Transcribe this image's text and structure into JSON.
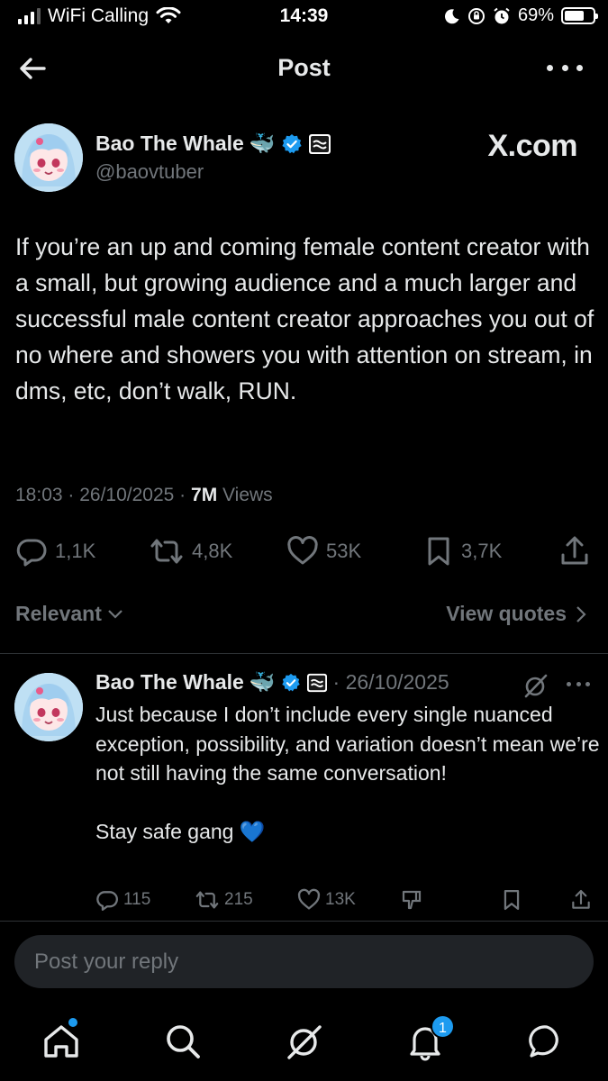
{
  "status_bar": {
    "carrier": "WiFi Calling",
    "time": "14:39",
    "battery": "69%",
    "battery_level": 0.69
  },
  "header": {
    "title": "Post"
  },
  "post": {
    "author_name": "Bao The Whale",
    "name_emoji": "🐳",
    "handle": "@baovtuber",
    "brand": "X.com",
    "text": "If you’re an up and coming female content creator with a small, but growing audience and a much larger and successful male content creator approaches you out of no where and showers you with attention on stream, in dms, etc, don’t walk, RUN.",
    "time": "18:03",
    "date": "26/10/2025",
    "views_count": "7M",
    "views_label": "Views",
    "replies": "1,1K",
    "reposts": "4,8K",
    "likes": "53K",
    "bookmarks": "3,7K"
  },
  "filters": {
    "sort_label": "Relevant",
    "quotes_label": "View quotes"
  },
  "reply": {
    "author_name": "Bao The Whale",
    "name_emoji": "🐳",
    "date": "26/10/2025",
    "text_line1": "Just because I don’t include every single nuanced exception, possibility, and variation doesn’t mean we’re not still having the same conversation!",
    "text_line2": "Stay safe gang 💙",
    "replies": "115",
    "reposts": "215",
    "likes": "13K"
  },
  "composer": {
    "placeholder": "Post your reply"
  },
  "bottom_nav": {
    "notifications_badge": "1",
    "items": [
      "home-icon",
      "search-icon",
      "grok-icon",
      "notifications-icon",
      "messages-icon"
    ]
  },
  "colors": {
    "background": "#000000",
    "text": "#e7e9ea",
    "secondary": "#71767b",
    "accent": "#1d9bf0",
    "divider": "#2f3336"
  }
}
